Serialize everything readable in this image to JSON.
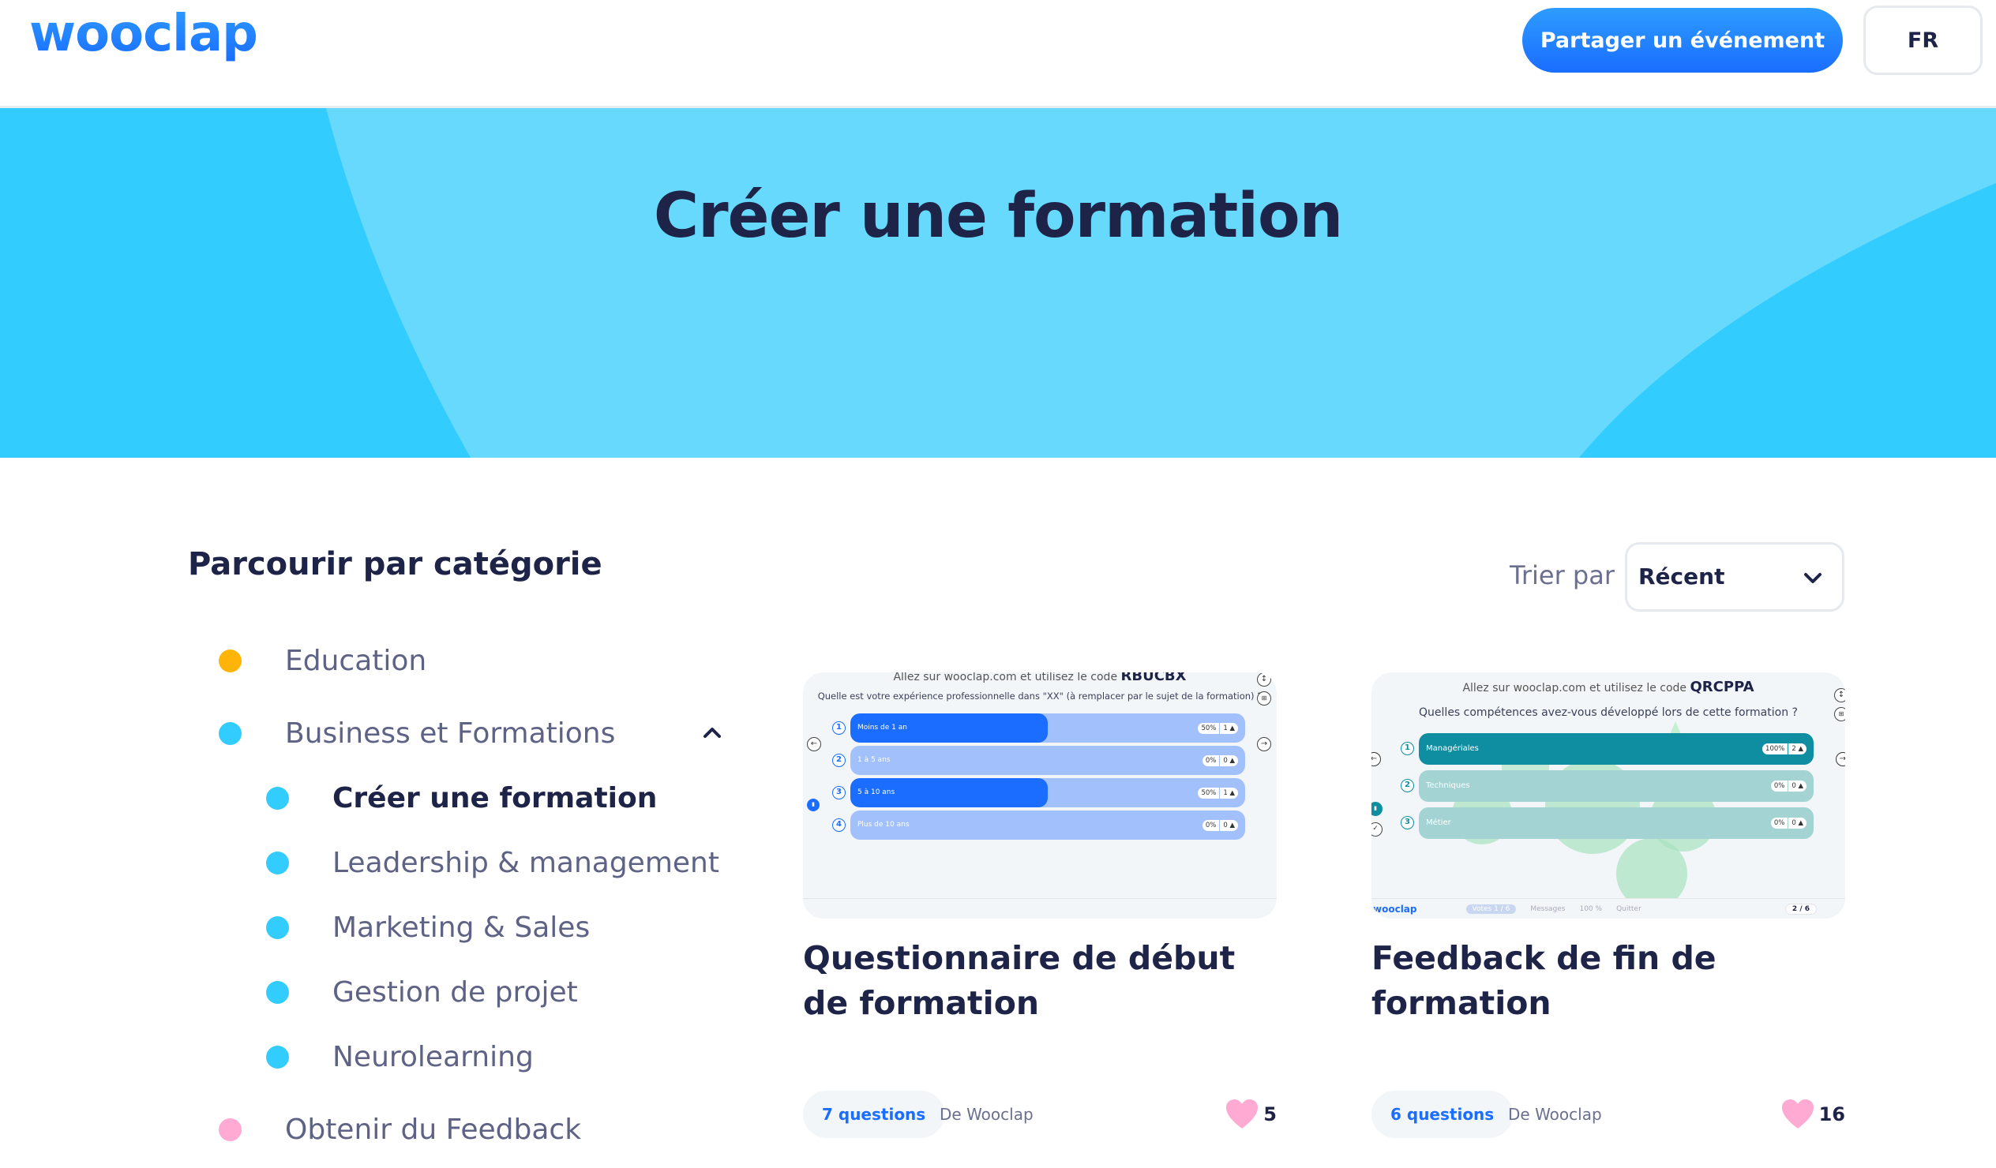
{
  "header": {
    "logo": "wooclap",
    "share_button": "Partager un événement",
    "language": "FR"
  },
  "hero": {
    "title": "Créer une formation"
  },
  "sidebar": {
    "title": "Parcourir par catégorie",
    "categories": [
      {
        "label": "Education",
        "color": "#ffb40a",
        "level": 0,
        "active": false
      },
      {
        "label": "Business et Formations",
        "color": "#33ccff",
        "level": 0,
        "active": false,
        "expanded": true
      },
      {
        "label": "Créer une formation",
        "color": "#33ccff",
        "level": 1,
        "active": true
      },
      {
        "label": "Leadership & management",
        "color": "#33ccff",
        "level": 1,
        "active": false
      },
      {
        "label": "Marketing & Sales",
        "color": "#33ccff",
        "level": 1,
        "active": false
      },
      {
        "label": "Gestion de projet",
        "color": "#33ccff",
        "level": 1,
        "active": false
      },
      {
        "label": "Neurolearning",
        "color": "#33ccff",
        "level": 1,
        "active": false
      },
      {
        "label": "Obtenir du Feedback",
        "color": "#ffaad2",
        "level": 0,
        "active": false
      }
    ]
  },
  "sort": {
    "label": "Trier par :",
    "selected": "Récent"
  },
  "cards": [
    {
      "title": "Questionnaire de début de formation",
      "questions": "7 questions",
      "author": "De Wooclap",
      "likes": "5",
      "thumbnail": {
        "code_prefix": "Allez sur wooclap.com et utilisez le code",
        "code": "RBUCBX",
        "question": "Quelle est votre expérience professionnelle dans \"XX\" (à remplacer par le sujet de la formation) ?",
        "accent": "#1a6dff",
        "track": "#a2c0fb",
        "options": [
          {
            "num": "1",
            "label": "Moins de 1 an",
            "percent": "50%",
            "count": "1",
            "fraction": 0.5
          },
          {
            "num": "2",
            "label": "1 à 5 ans",
            "percent": "0%",
            "count": "0",
            "fraction": 0
          },
          {
            "num": "3",
            "label": "5 à 10 ans",
            "percent": "50%",
            "count": "1",
            "fraction": 0.5
          },
          {
            "num": "4",
            "label": "Plus de 10 ans",
            "percent": "0%",
            "count": "0",
            "fraction": 0
          }
        ]
      }
    },
    {
      "title": "Feedback de fin de formation",
      "questions": "6 questions",
      "author": "De Wooclap",
      "likes": "16",
      "thumbnail": {
        "code_prefix": "Allez sur wooclap.com et utilisez le code",
        "code": "QRCPPA",
        "question": "Quelles compétences avez-vous développé lors de cette formation ?",
        "accent": "#0e8ea0",
        "track": "#a3d3d3",
        "options": [
          {
            "num": "1",
            "label": "Managériales",
            "percent": "100%",
            "count": "2",
            "fraction": 1
          },
          {
            "num": "2",
            "label": "Techniques",
            "percent": "0%",
            "count": "0",
            "fraction": 0
          },
          {
            "num": "3",
            "label": "Métier",
            "percent": "0%",
            "count": "0",
            "fraction": 0
          }
        ],
        "toolbar": {
          "logo": "wooclap",
          "votes": "Votes",
          "votes_count": "1 / 6",
          "messages": "Messages",
          "zoom": "100 %",
          "quit": "Quitter",
          "participants": "2 / 6"
        }
      }
    }
  ]
}
